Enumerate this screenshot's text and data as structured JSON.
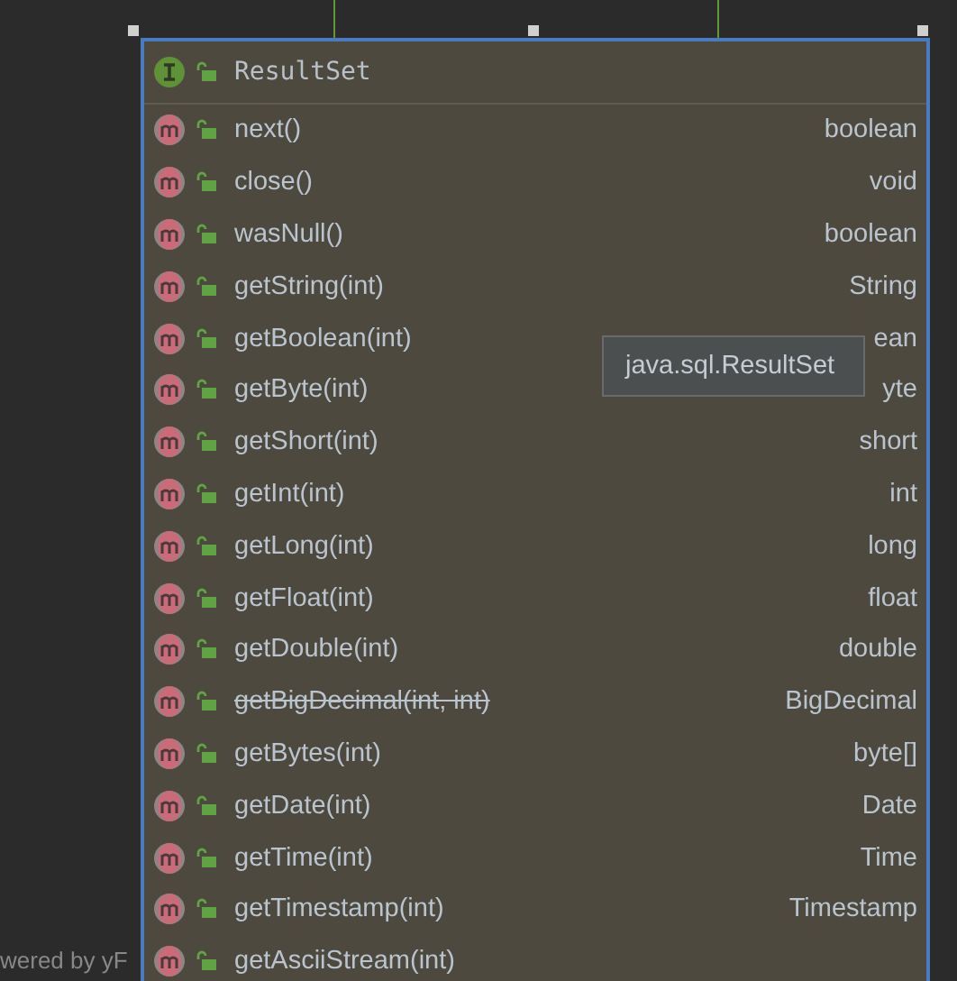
{
  "canvas": {
    "footer_text": "wered by yF"
  },
  "popup": {
    "title": "ResultSet",
    "members": [
      {
        "name": "next()",
        "type": "boolean",
        "deprecated": false
      },
      {
        "name": "close()",
        "type": "void",
        "deprecated": false
      },
      {
        "name": "wasNull()",
        "type": "boolean",
        "deprecated": false
      },
      {
        "name": "getString(int)",
        "type": "String",
        "deprecated": false
      },
      {
        "name": "getBoolean(int)",
        "type": "ean",
        "deprecated": false
      },
      {
        "name": "getByte(int)",
        "type": "yte",
        "deprecated": false
      },
      {
        "name": "getShort(int)",
        "type": "short",
        "deprecated": false
      },
      {
        "name": "getInt(int)",
        "type": "int",
        "deprecated": false
      },
      {
        "name": "getLong(int)",
        "type": "long",
        "deprecated": false
      },
      {
        "name": "getFloat(int)",
        "type": "float",
        "deprecated": false
      },
      {
        "name": "getDouble(int)",
        "type": "double",
        "deprecated": false
      },
      {
        "name": "getBigDecimal(int, int)",
        "type": "BigDecimal",
        "deprecated": true
      },
      {
        "name": "getBytes(int)",
        "type": "byte[]",
        "deprecated": false
      },
      {
        "name": "getDate(int)",
        "type": "Date",
        "deprecated": false
      },
      {
        "name": "getTime(int)",
        "type": "Time",
        "deprecated": false
      },
      {
        "name": "getTimestamp(int)",
        "type": "Timestamp",
        "deprecated": false
      },
      {
        "name": "getAsciiStream(int)",
        "deprecated": false
      }
    ],
    "tooltip": "java.sql.ResultSet"
  }
}
